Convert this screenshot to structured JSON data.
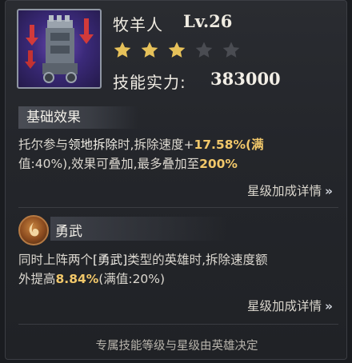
{
  "skill": {
    "name": "牧羊人",
    "level": "Lv.26",
    "stars_total": 5,
    "stars_filled": 3,
    "power_label": "技能实力:",
    "power_value": "383000"
  },
  "base_effect": {
    "header": "基础效果",
    "line1": {
      "t1": "托尔参与",
      "t2": "领地拆除",
      "t3": "时,拆除速度+",
      "t4": "17.58%",
      "t5": "(满"
    },
    "line2": {
      "t1": "值:40%),效果可叠加,最多叠加至",
      "t2": "200%"
    },
    "link": "星级加成详情",
    "chevron": "»"
  },
  "trait": {
    "name": "勇武",
    "line1": {
      "t1": "同时上阵两个",
      "t2": "[勇武]",
      "t3": "类型的英雄时,拆除速度额"
    },
    "line2": {
      "t1": "外提高",
      "t2": "8.84%",
      "t3": "(满值:20%)"
    },
    "link": "星级加成详情",
    "chevron": "»"
  },
  "footer": "专属技能等级与星级由英雄决定",
  "colors": {
    "star_filled": "#e6c15a",
    "star_empty": "#4a4c52",
    "highlight_number": "#f2c86a",
    "arrow_red": "#d23a3a"
  },
  "icons": {
    "portrait": "siege-tower-icon",
    "trait_badge": "flame-swirl-icon",
    "star": "star-icon",
    "chevron": "double-chevron-right-icon"
  }
}
